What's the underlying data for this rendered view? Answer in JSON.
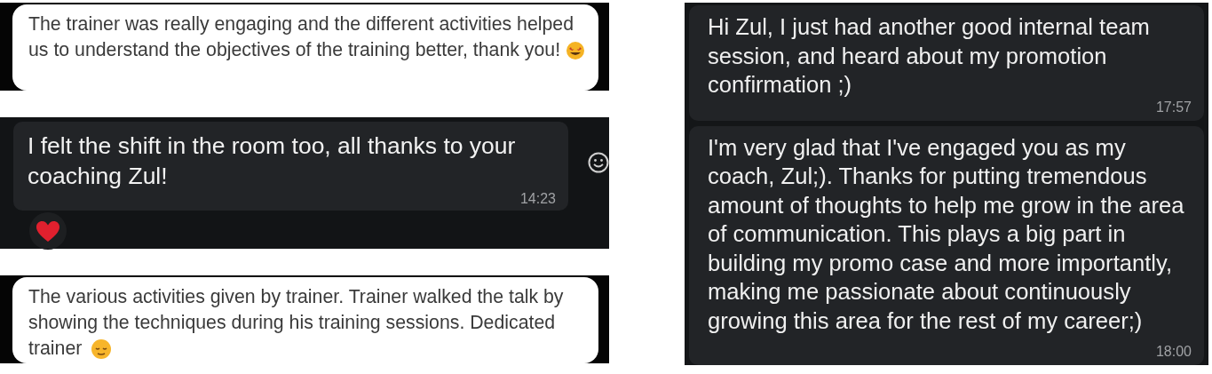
{
  "left_column": {
    "cards": [
      {
        "kind": "light",
        "text": "The trainer was really engaging and the different activities helped us to understand the objectives of the training better, thank you!",
        "emoji": {
          "kind": "star_struck"
        }
      },
      {
        "kind": "dark",
        "text": "I felt the shift in the room too, all thanks to your coaching Zul!",
        "time": "14:23",
        "reaction": {
          "kind": "heart"
        },
        "react_button": true
      },
      {
        "kind": "light",
        "text": "The various activities given by trainer. Trainer walked the talk by showing the techniques during his training sessions. Dedicated trainer",
        "emoji": {
          "kind": "relieved"
        }
      }
    ]
  },
  "right_panel": {
    "messages": [
      {
        "text": "Hi Zul, I just had another good internal team session, and heard about my promotion confirmation ;)",
        "time": "17:57"
      },
      {
        "text": "I'm very glad that I've engaged you as my coach, Zul;). Thanks for putting tremendous amount of thoughts to help me grow in the area of communication. This plays a big part in building my promo case and more importantly, making me passionate about continuously growing this area for the rest of my career;)",
        "time": "18:00"
      }
    ]
  }
}
